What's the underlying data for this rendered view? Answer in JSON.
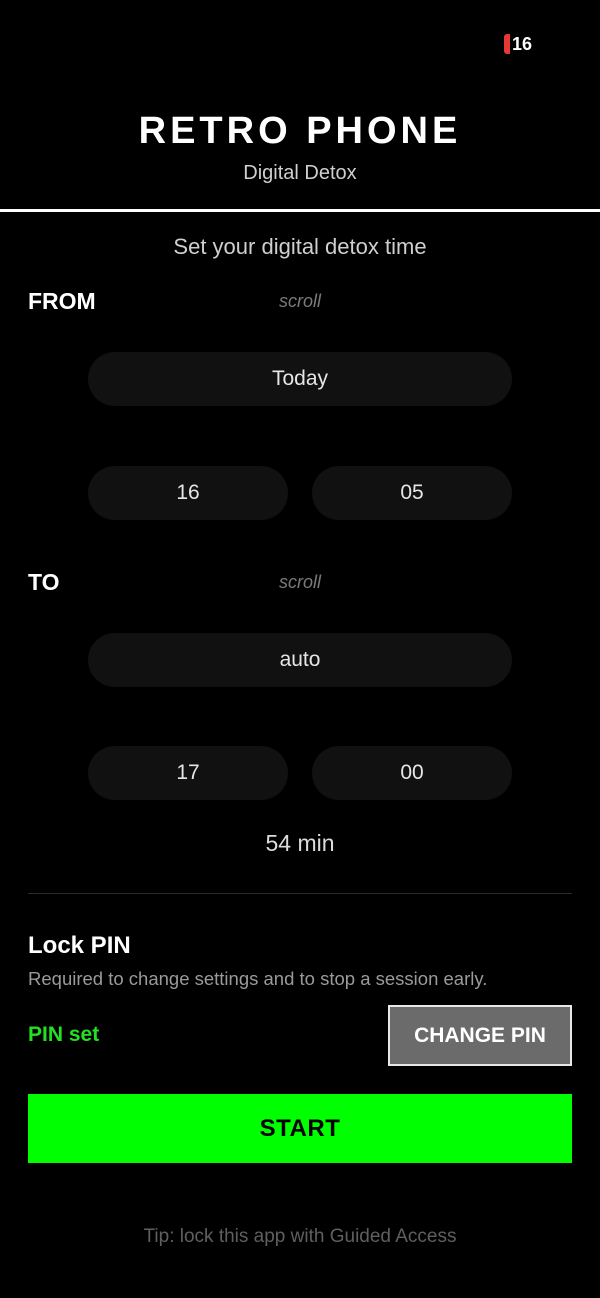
{
  "status_bar": {
    "battery_level": "16"
  },
  "header": {
    "title": "RETRO PHONE",
    "subtitle": "Digital Detox"
  },
  "instruction": "Set your digital detox time",
  "from": {
    "label": "FROM",
    "scroll_hint": "scroll",
    "day": "Today",
    "hour": "16",
    "minute": "05"
  },
  "to": {
    "label": "TO",
    "scroll_hint": "scroll",
    "day": "auto",
    "hour": "17",
    "minute": "00"
  },
  "duration": "54 min",
  "lock_pin": {
    "title": "Lock PIN",
    "description": "Required to change settings and to stop a session early.",
    "status": "PIN set",
    "change_button_label": "CHANGE PIN"
  },
  "start_button_label": "START",
  "tip": "Tip: lock this app with Guided Access",
  "colors": {
    "accent_green": "#00ff00",
    "pin_status_green": "#22e022",
    "battery_red": "#e53935",
    "background": "#000000"
  }
}
